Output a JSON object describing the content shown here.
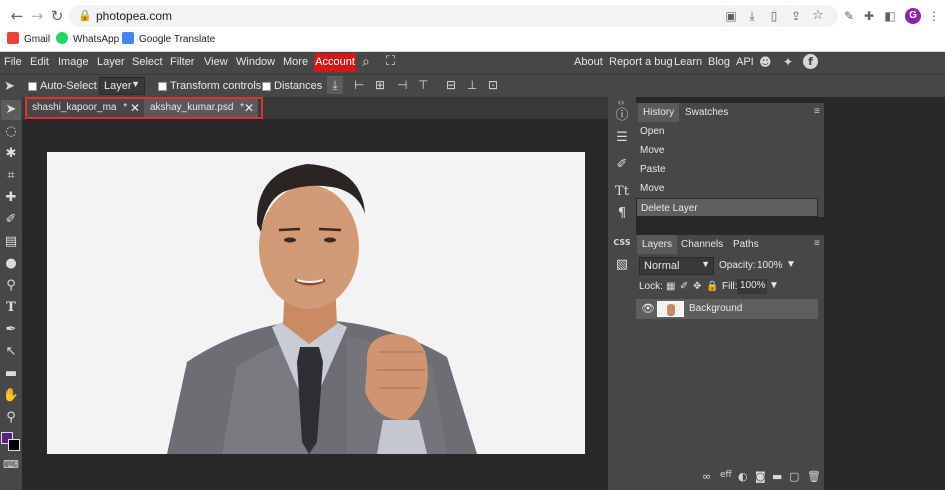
{
  "browser": {
    "url": "photopea.com",
    "bookmarks": [
      {
        "label": "Gmail",
        "icon": "gmail-icon"
      },
      {
        "label": "WhatsApp",
        "icon": "whatsapp-icon"
      },
      {
        "label": "Google Translate",
        "icon": "translate-icon"
      }
    ],
    "profile_initial": "G"
  },
  "menu": {
    "items": [
      "File",
      "Edit",
      "Image",
      "Layer",
      "Select",
      "Filter",
      "View",
      "Window",
      "More"
    ],
    "account": "Account",
    "right": [
      "About",
      "Report a bug",
      "Learn",
      "Blog",
      "API"
    ]
  },
  "options": {
    "auto_select": "Auto-Select",
    "layer_select": "Layer",
    "transform_controls": "Transform controls",
    "distances": "Distances"
  },
  "tabs": [
    {
      "label": "shashi_kapoor_ma",
      "modified": "*"
    },
    {
      "label": "akshay_kumar.psd",
      "modified": "*"
    }
  ],
  "history": {
    "tabs": [
      "History",
      "Swatches"
    ],
    "items": [
      "Open",
      "Move",
      "Paste",
      "Move",
      "Delete Layer"
    ]
  },
  "layers": {
    "tabs": [
      "Layers",
      "Channels",
      "Paths"
    ],
    "blend_mode": "Normal",
    "opacity_label": "Opacity:",
    "opacity": "100%",
    "lock_label": "Lock:",
    "fill_label": "Fill:",
    "fill": "100%",
    "layer_name": "Background"
  },
  "side_icons": {
    "css": "CSS"
  },
  "colors": {
    "accent_red": "#d01919",
    "highlight_border": "#e03030",
    "foreground": "#5b1f8a",
    "background": "#000000"
  }
}
